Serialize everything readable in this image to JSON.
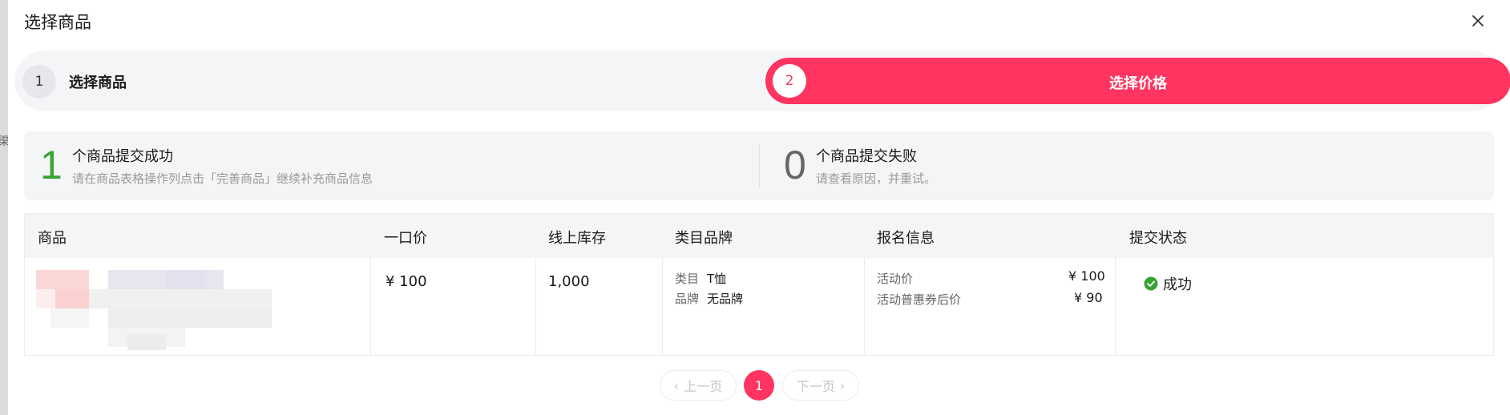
{
  "background_text": "渠",
  "modal": {
    "title": "选择商品",
    "close_icon": "close-icon"
  },
  "steps": [
    {
      "number": "1",
      "label": "选择商品",
      "active": false
    },
    {
      "number": "2",
      "label": "选择价格",
      "active": true
    }
  ],
  "summary": {
    "success": {
      "count": "1",
      "title": "个商品提交成功",
      "subtitle": "请在商品表格操作列点击「完善商品」继续补充商品信息",
      "color": "#3aa335"
    },
    "failure": {
      "count": "0",
      "title": "个商品提交失败",
      "subtitle": "请查看原因，并重试。",
      "color": "#666666"
    }
  },
  "table": {
    "headers": [
      "商品",
      "一口价",
      "线上库存",
      "类目品牌",
      "报名信息",
      "提交状态"
    ],
    "rows": [
      {
        "product_image": "blurred-product-thumbnail",
        "price": "¥ 100",
        "stock": "1,000",
        "category_label": "类目",
        "category_value": "T恤",
        "brand_label": "品牌",
        "brand_value": "无品牌",
        "activity_price_label": "活动价",
        "activity_price_value": "¥ 100",
        "coupon_price_label": "活动普惠券后价",
        "coupon_price_value": "¥ 90",
        "status": "成功",
        "status_icon": "check-circle-icon"
      }
    ]
  },
  "pagination": {
    "prev_label": "上一页",
    "current_page": "1",
    "next_label": "下一页"
  },
  "colors": {
    "accent": "#ff3460",
    "success": "#3aa335"
  }
}
